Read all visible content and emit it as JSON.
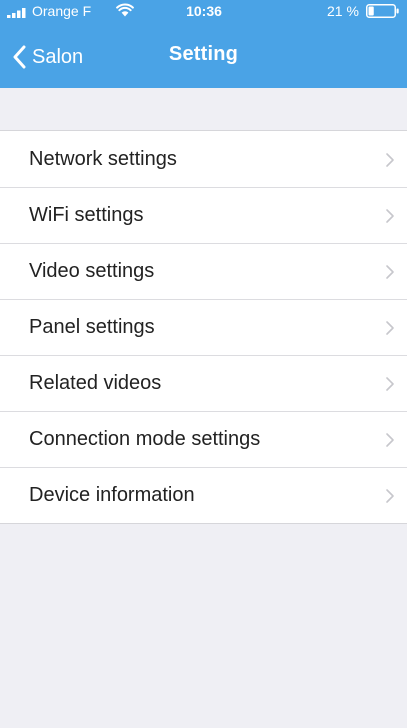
{
  "status_bar": {
    "carrier": "Orange F",
    "time": "10:36",
    "battery_percent": "21 %",
    "battery_level": 0.21,
    "signal_icon": "signal-bars-icon",
    "wifi_icon": "wifi-icon",
    "battery_icon": "battery-icon"
  },
  "nav": {
    "back_label": "Salon",
    "title": "Setting",
    "back_icon": "chevron-left-icon"
  },
  "settings": {
    "items": [
      {
        "label": "Network settings"
      },
      {
        "label": "WiFi settings"
      },
      {
        "label": "Video settings"
      },
      {
        "label": "Panel settings"
      },
      {
        "label": "Related videos"
      },
      {
        "label": "Connection mode settings"
      },
      {
        "label": "Device information"
      }
    ],
    "row_icon": "chevron-right-icon"
  },
  "colors": {
    "nav_background": "#4aa3e6",
    "page_background": "#efeff4",
    "row_background": "#ffffff",
    "chevron": "#c7c7cc"
  }
}
